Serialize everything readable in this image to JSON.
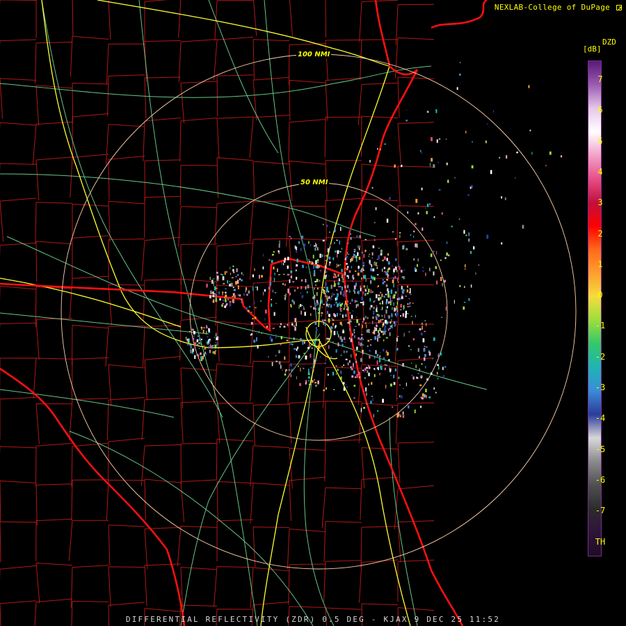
{
  "credit": "NEXLAB-College of DuPage",
  "credit_icon": "external-link-icon",
  "legend": {
    "title": "DZD",
    "unit": "[dB]",
    "ticks": [
      "7",
      "6",
      "5",
      "4",
      "3",
      "2",
      "1",
      "0",
      "-1",
      "-2",
      "-3",
      "-4",
      "-5",
      "-6",
      "-7",
      "TH"
    ],
    "colors": [
      "#5a1a78",
      "#9a5db0",
      "#e6c7e8",
      "#ffffff",
      "#f2a2c8",
      "#e84e86",
      "#c0103a",
      "#ff0000",
      "#ff6a1a",
      "#ff9f2e",
      "#f4dc3c",
      "#9adf3c",
      "#34c86a",
      "#1fb4b4",
      "#3a8cd8",
      "#2a3c9a",
      "#d8d8d8",
      "#8a8a8a",
      "#505050",
      "#2c2c2c",
      "#2e1438",
      "#1e0d24"
    ]
  },
  "rings": [
    "100 NMI",
    "50 NMI"
  ],
  "footer": "DIFFERENTIAL REFLECTIVITY (ZDR) 0.5 DEG - KJAX 9 DEC 25 11:52",
  "colors": {
    "state_border": "#ff1010",
    "county_border": "#b01818",
    "highway": "#ffff33",
    "road": "#78e8a0",
    "range_ring": "#ffd0a8"
  }
}
